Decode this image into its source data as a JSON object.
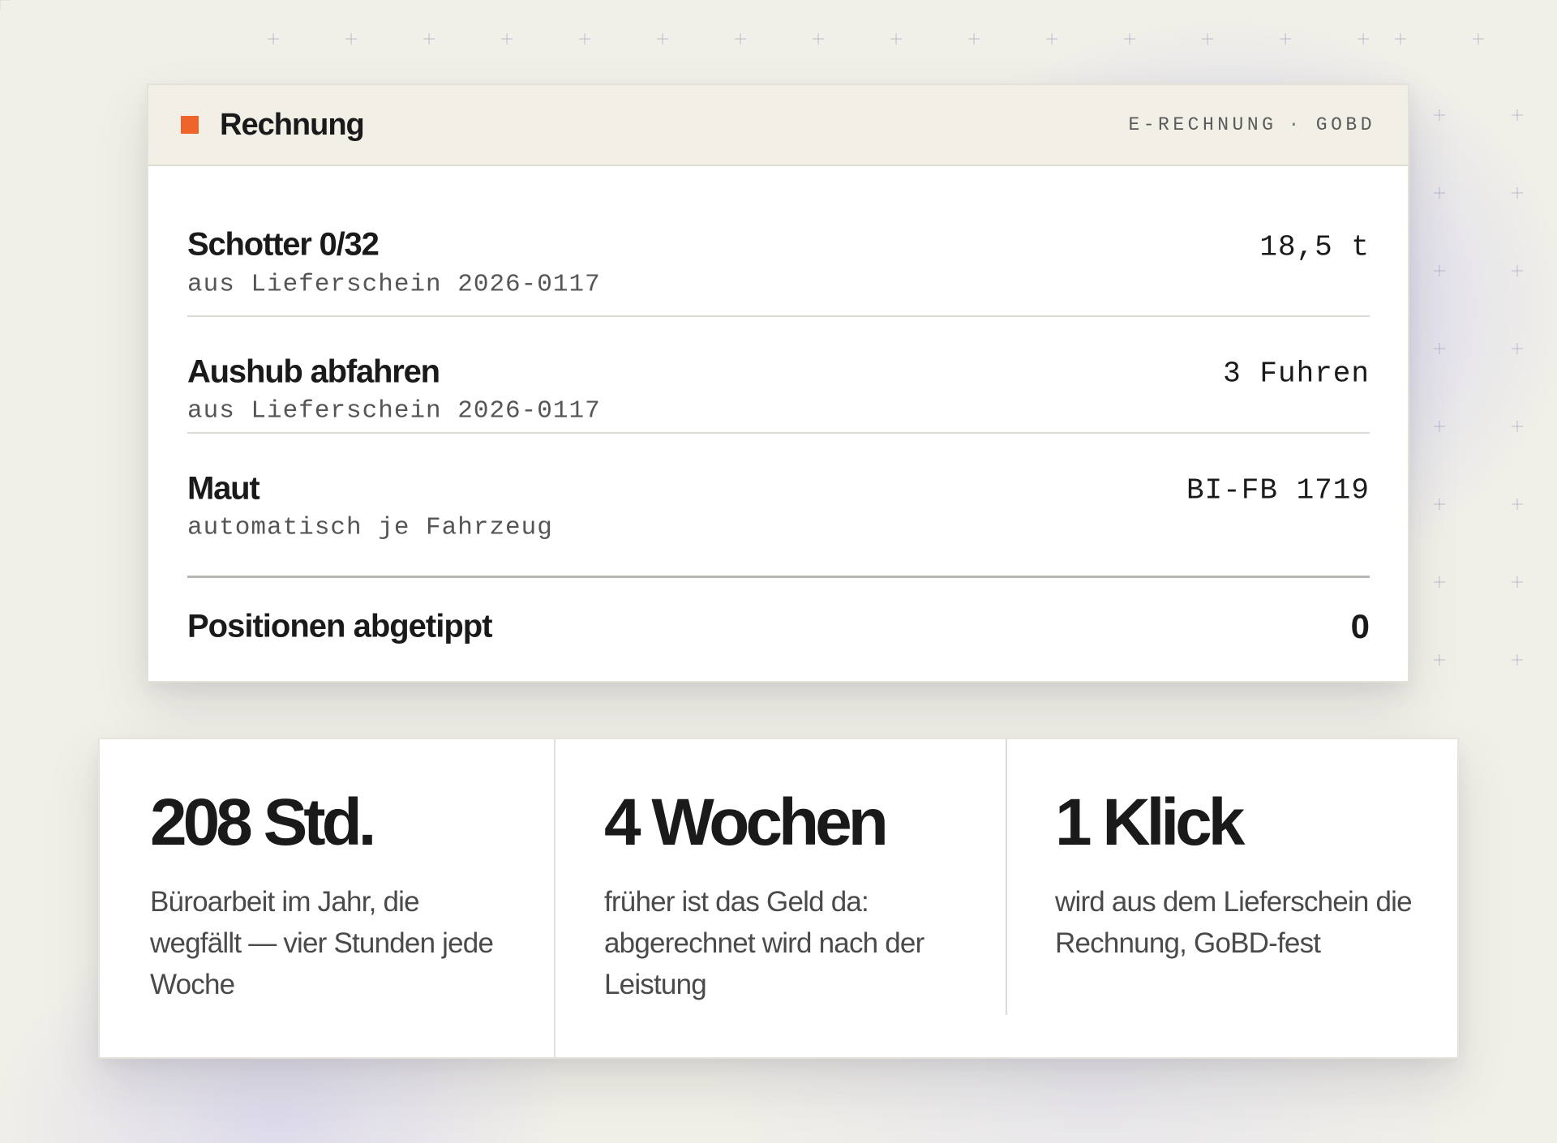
{
  "colors": {
    "accent": "#ef6428",
    "text": "#1a1a1a",
    "muted": "#555555",
    "background": "#f1f0e8",
    "header_bg": "#f1efe6",
    "glow": "#c4c0f0"
  },
  "invoice": {
    "status_icon": "orange-square-icon",
    "title": "Rechnung",
    "tags": [
      "E-RECHNUNG",
      "GOBD"
    ],
    "tag_separator": "·",
    "items": [
      {
        "name": "Schotter 0/32",
        "source": "aus Lieferschein 2026-0117",
        "quantity": "18,5 t"
      },
      {
        "name": "Aushub abfahren",
        "source": "aus Lieferschein 2026-0117",
        "quantity": "3 Fuhren"
      },
      {
        "name": "Maut",
        "source": "automatisch je Fahrzeug",
        "quantity": "BI-FB 1719"
      }
    ],
    "summary": {
      "label": "Positionen abgetippt",
      "value": "0"
    }
  },
  "stats": [
    {
      "value": "208 Std.",
      "description": "Büroarbeit im Jahr, die wegfällt — vier Stunden jede Woche"
    },
    {
      "value": "4 Wochen",
      "description": "früher ist das Geld da: abgerechnet wird nach der Leistung"
    },
    {
      "value": "1 Klick",
      "description": "wird aus dem Lieferschein die Rechnung, GoBD-fest"
    }
  ]
}
